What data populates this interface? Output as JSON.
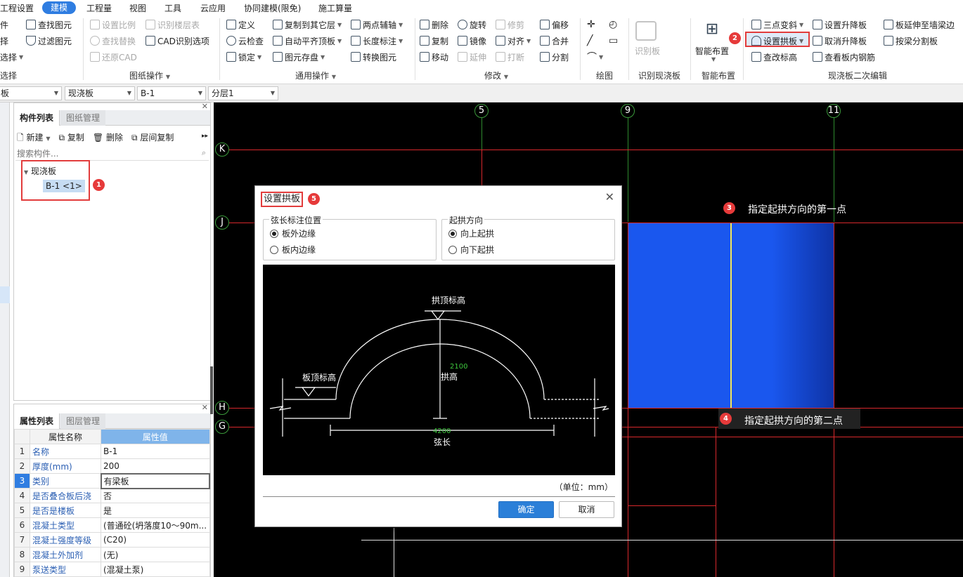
{
  "menubar": [
    "工程设置",
    "建模",
    "工程量",
    "视图",
    "工具",
    "云应用",
    "协同建模(限免)",
    "施工算量"
  ],
  "ribbon": {
    "left_col": [
      "件",
      "择",
      "选择",
      "选择"
    ],
    "find": "查找图元",
    "filter": "过滤图元",
    "drawing_ops": [
      "设置比例",
      "识别楼层表",
      "查找替换",
      "CAD识别选项",
      "还原CAD"
    ],
    "drawing_group": "图纸操作",
    "common_ops": [
      "定义",
      "复制到其它层",
      "两点辅轴",
      "云检查",
      "自动平齐顶板",
      "长度标注",
      "锁定",
      "图元存盘",
      "转换图元"
    ],
    "common_group": "通用操作",
    "modify_ops": [
      "删除",
      "旋转",
      "修剪",
      "偏移",
      "复制",
      "镜像",
      "对齐",
      "合并",
      "移动",
      "延伸",
      "打断",
      "分割"
    ],
    "modify_group": "修改",
    "draw_group": "绘图",
    "identify_label": "识别板",
    "identify_group": "识别现浇板",
    "smart_label": "智能布置",
    "smart_group": "智能布置",
    "second_edit": [
      "三点变斜",
      "设置升降板",
      "板延伸至墙梁边",
      "设置拱板",
      "取消升降板",
      "按梁分割板",
      "查改标高",
      "查看板内钢筋"
    ],
    "second_group": "现浇板二次编辑"
  },
  "selectors": [
    "板",
    "现浇板",
    "B-1",
    "分层1"
  ],
  "component_panel": {
    "tabs": [
      "构件列表",
      "图纸管理"
    ],
    "toolbar": [
      "新建",
      "复制",
      "删除",
      "层间复制"
    ],
    "search_placeholder": "搜索构件...",
    "tree_parent": "现浇板",
    "tree_child": "B-1 <1>"
  },
  "property_panel": {
    "tabs": [
      "属性列表",
      "图层管理"
    ],
    "headers": [
      "属性名称",
      "属性值"
    ],
    "rows": [
      {
        "n": "1",
        "k": "名称",
        "v": "B-1"
      },
      {
        "n": "2",
        "k": "厚度(mm)",
        "v": "200"
      },
      {
        "n": "3",
        "k": "类别",
        "v": "有梁板"
      },
      {
        "n": "4",
        "k": "是否叠合板后浇",
        "v": "否"
      },
      {
        "n": "5",
        "k": "是否是楼板",
        "v": "是"
      },
      {
        "n": "6",
        "k": "混凝土类型",
        "v": "(普通砼(坍落度10～90m..."
      },
      {
        "n": "7",
        "k": "混凝土强度等级",
        "v": "(C20)"
      },
      {
        "n": "8",
        "k": "混凝土外加剂",
        "v": "(无)"
      },
      {
        "n": "9",
        "k": "泵送类型",
        "v": "(混凝土泵)"
      }
    ]
  },
  "axes": {
    "vertical": [
      "5",
      "9",
      "11"
    ],
    "horizontal": [
      "K",
      "J",
      "H",
      "G"
    ]
  },
  "badges": [
    "1",
    "2",
    "3",
    "4",
    "5"
  ],
  "hints": {
    "first": "指定起拱方向的第一点",
    "second": "指定起拱方向的第二点"
  },
  "dialog": {
    "title": "设置拱板",
    "chord_group": "弦长标注位置",
    "chord_options": [
      "板外边缘",
      "板内边缘"
    ],
    "dir_group": "起拱方向",
    "dir_options": [
      "向上起拱",
      "向下起拱"
    ],
    "diagram": {
      "top_elev": "拱顶标高",
      "slab_elev": "板顶标高",
      "rise_value": "2100",
      "rise_label": "拱高",
      "chord_value": "4200",
      "chord_label": "弦长"
    },
    "unit": "（单位：mm）",
    "ok": "确定",
    "cancel": "取消"
  },
  "colors": {
    "accent": "#2f7de1",
    "badge": "#e63a3a",
    "slab": "#1a57ee",
    "grid_red": "#d8282c",
    "axis_green": "#3b9a3b"
  }
}
